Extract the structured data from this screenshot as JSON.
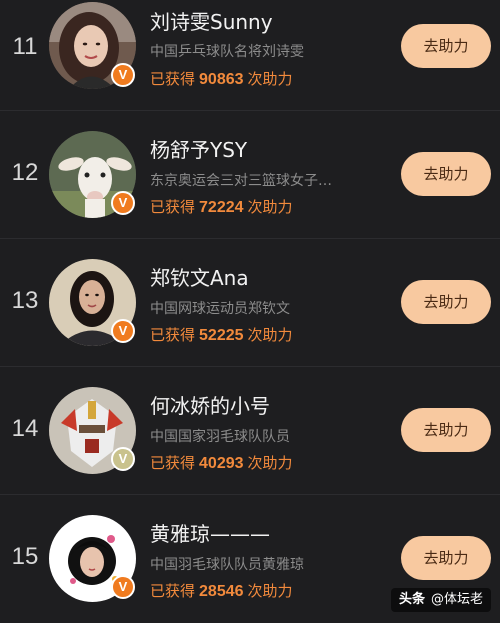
{
  "rows": [
    {
      "rank": "11",
      "name": "刘诗雯Sunny",
      "desc": "中国乒乓球队名将刘诗雯",
      "support_prefix": "已获得",
      "support_count": "90863",
      "support_suffix": "次助力",
      "button_label": "去助力",
      "badge": "V",
      "avatar_icon": "person-photo"
    },
    {
      "rank": "12",
      "name": "杨舒予YSY",
      "desc": "东京奥运会三对三篮球女子…",
      "support_prefix": "已获得",
      "support_count": "72224",
      "support_suffix": "次助力",
      "button_label": "去助力",
      "badge": "V",
      "avatar_icon": "lamb-photo"
    },
    {
      "rank": "13",
      "name": "郑钦文Ana",
      "desc": "中国网球运动员郑钦文",
      "support_prefix": "已获得",
      "support_count": "52225",
      "support_suffix": "次助力",
      "button_label": "去助力",
      "badge": "V",
      "avatar_icon": "person-photo"
    },
    {
      "rank": "14",
      "name": "何冰娇的小号",
      "desc": "中国国家羽毛球队队员",
      "support_prefix": "已获得",
      "support_count": "40293",
      "support_suffix": "次助力",
      "button_label": "去助力",
      "badge": "V",
      "avatar_icon": "robot-photo"
    },
    {
      "rank": "15",
      "name": "黄雅琼———",
      "desc": "中国羽毛球队队员黄雅琼",
      "support_prefix": "已获得",
      "support_count": "28546",
      "support_suffix": "次助力",
      "button_label": "去助力",
      "badge": "V",
      "avatar_icon": "person-photo"
    }
  ],
  "watermark": {
    "logo": "头条",
    "text": "@体坛老"
  },
  "colors": {
    "background": "#1e1e20",
    "accent": "#f28a3c",
    "button_bg": "#f8c9a0",
    "badge": "#f07b1f"
  }
}
